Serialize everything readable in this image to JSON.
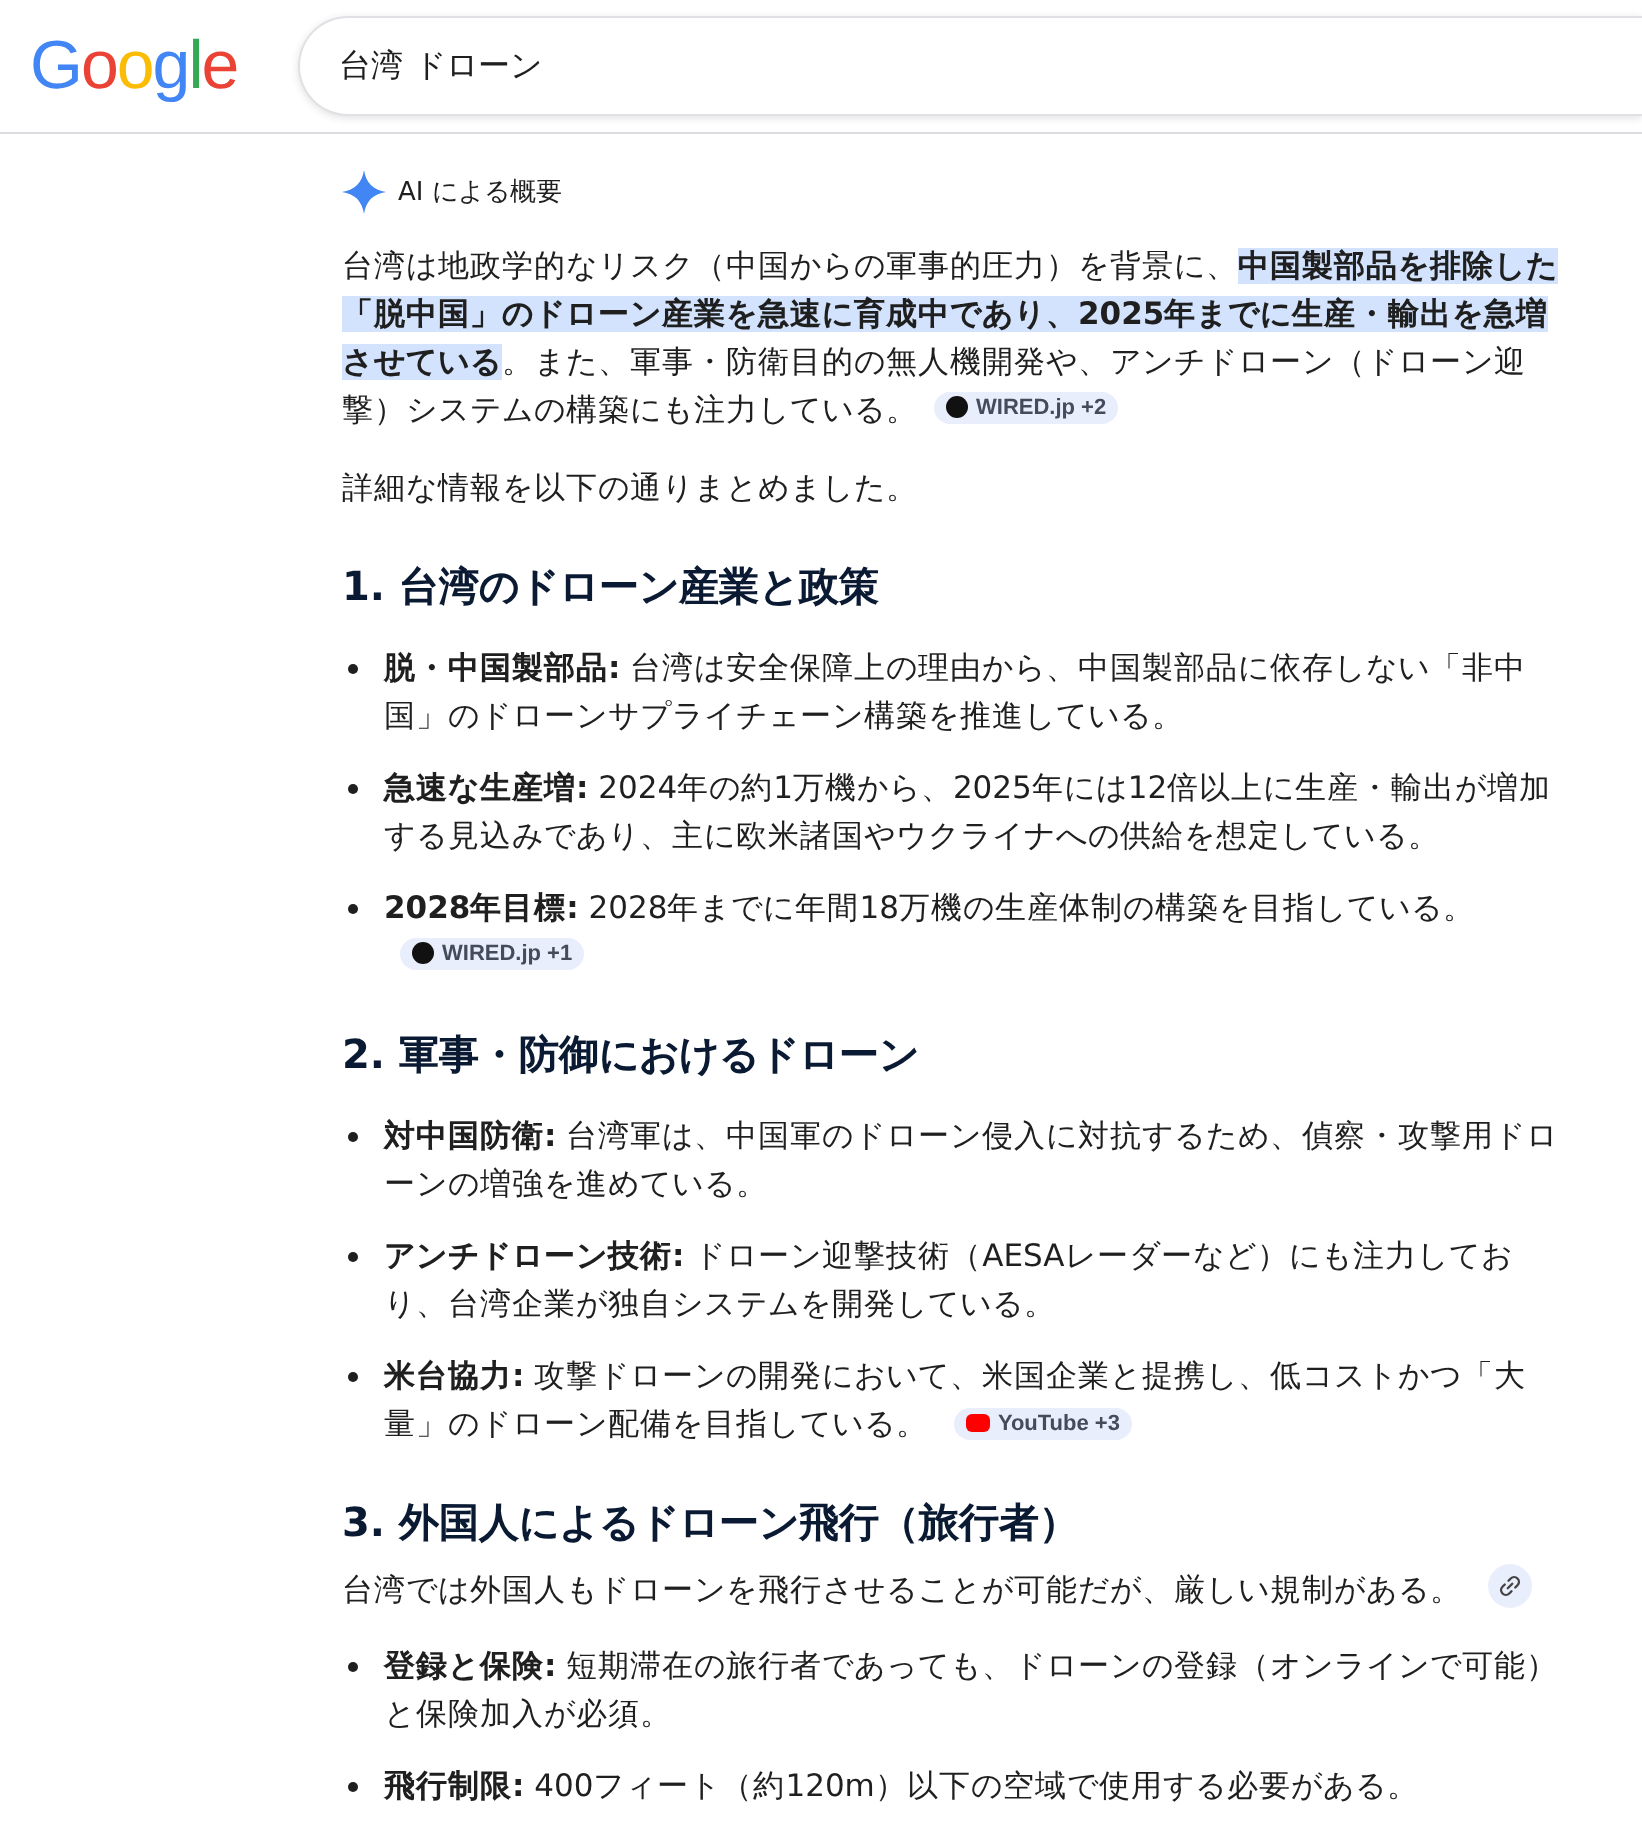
{
  "logo": {
    "letters": [
      "G",
      "o",
      "o",
      "g",
      "l",
      "e"
    ]
  },
  "search": {
    "value": "台湾 ドローン"
  },
  "ai_overview": {
    "label": "AI による概要",
    "summary": "台湾は地政学的なリスク（中国からの軍事的圧力）を背景に、**中国製部品を排除した「脱中国」のドローン産業を急速に育成中であり、2025年までに生産・輸出を急増させている**。また、軍事・防衛目的の無人機開発や、アンチドローン（ドローン迎撃）システムの構築にも注力している。",
    "summary_citation": {
      "kind": "wired",
      "label": "WIRED.jp +2"
    },
    "lead": "詳細な情報を以下の通りまとめました。",
    "sections": [
      {
        "heading": "1. 台湾のドローン産業と政策",
        "items": [
          {
            "term": "脱・中国製部品:",
            "text": "台湾は安全保障上の理由から、中国製部品に依存しない「非中国」のドローンサプライチェーン構築を推進している。"
          },
          {
            "term": "急速な生産増:",
            "text": "2024年の約1万機から、2025年には12倍以上に生産・輸出が増加する見込みであり、主に欧米諸国やウクライナへの供給を想定している。"
          },
          {
            "term": "2028年目標:",
            "text": "2028年までに年間18万機の生産体制の構築を目指している。",
            "citation": {
              "kind": "wired",
              "label": "WIRED.jp +1"
            }
          }
        ]
      },
      {
        "heading": "2. 軍事・防御におけるドローン",
        "items": [
          {
            "term": "対中国防衛:",
            "text": "台湾軍は、中国軍のドローン侵入に対抗するため、偵察・攻撃用ドローンの増強を進めている。"
          },
          {
            "term": "アンチドローン技術:",
            "text": "ドローン迎撃技術（AESAレーダーなど）にも注力しており、台湾企業が独自システムを開発している。"
          },
          {
            "term": "米台協力:",
            "text": "攻撃ドローンの開発において、米国企業と提携し、低コストかつ「大量」のドローン配備を目指している。",
            "citation": {
              "kind": "youtube",
              "label": "YouTube +3"
            }
          }
        ]
      },
      {
        "heading": "3. 外国人によるドローン飛行（旅行者）",
        "intro": "台湾では外国人もドローンを飛行させることが可能だが、厳しい規制がある。",
        "intro_citation": {
          "kind": "link"
        },
        "items": [
          {
            "term": "登録と保険:",
            "text": "短期滞在の旅行者であっても、ドローンの登録（オンラインで可能）と保険加入が必須。"
          },
          {
            "term": "飛行制限:",
            "text": "400フィート（約120m）以下の空域で使用する必要がある。"
          }
        ]
      }
    ]
  }
}
